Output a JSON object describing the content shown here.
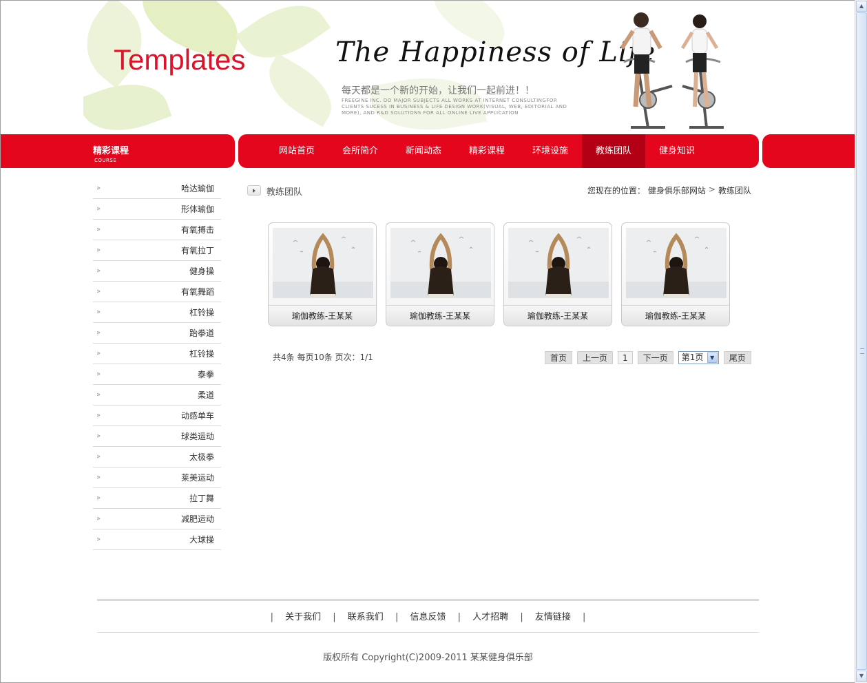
{
  "header": {
    "logo": "Templates",
    "slogan": "The Happiness of Life",
    "slogan_cn": "每天都是一个新的开始，让我们一起前进！！",
    "slogan_en": "FREEGINE INC. DO MAJOR SUBJECTS ALL WORKS AT INTERNET CONSULTINGFOR CLIENTS SUCESS IN BUSINESS & LIFE DESIGN WORK(VISUAL, WEB, EDITORIAL AND MORE), AND R&D SOLUTIONS FOR ALL ONLINE LIVE APPLICATION"
  },
  "sidebar": {
    "title": "精彩课程",
    "subtitle": "COURSE",
    "arrow": "»",
    "items": [
      {
        "label": "哈达瑜伽"
      },
      {
        "label": "形体瑜伽"
      },
      {
        "label": "有氧搏击"
      },
      {
        "label": "有氧拉丁"
      },
      {
        "label": "健身操"
      },
      {
        "label": "有氧舞蹈"
      },
      {
        "label": "杠铃操"
      },
      {
        "label": "跆拳道"
      },
      {
        "label": "杠铃操"
      },
      {
        "label": "泰拳"
      },
      {
        "label": "柔道"
      },
      {
        "label": "动感单车"
      },
      {
        "label": "球类运动"
      },
      {
        "label": "太极拳"
      },
      {
        "label": "莱美运动"
      },
      {
        "label": "拉丁舞"
      },
      {
        "label": "减肥运动"
      },
      {
        "label": "大球操"
      }
    ]
  },
  "nav": {
    "items": [
      {
        "label": "网站首页"
      },
      {
        "label": "会所简介"
      },
      {
        "label": "新闻动态"
      },
      {
        "label": "精彩课程"
      },
      {
        "label": "环境设施"
      },
      {
        "label": "教练团队"
      },
      {
        "label": "健身知识"
      }
    ],
    "active_label": "教练团队"
  },
  "content": {
    "section_title": "教练团队",
    "breadcrumb": {
      "prefix": "您现在的位置：",
      "home": "健身俱乐部网站",
      "separator": ">",
      "current": "教练团队"
    },
    "cards": [
      {
        "caption": "瑜伽教练-王某某"
      },
      {
        "caption": "瑜伽教练-王某某"
      },
      {
        "caption": "瑜伽教练-王某某"
      },
      {
        "caption": "瑜伽教练-王某某"
      }
    ],
    "pager": {
      "info": "共4条  每页10条  页次：1/1",
      "first": "首页",
      "prev": "上一页",
      "current_page": "1",
      "next": "下一页",
      "select_value": "第1页",
      "last": "尾页"
    }
  },
  "footer": {
    "links": [
      {
        "label": "关于我们"
      },
      {
        "label": "联系我们"
      },
      {
        "label": "信息反馈"
      },
      {
        "label": "人才招聘"
      },
      {
        "label": "友情链接"
      }
    ],
    "separator": "|",
    "copyright": "版权所有 Copyright(C)2009-2011 某某健身俱乐部"
  },
  "colors": {
    "brand_red": "#e3061d",
    "nav_active": "#b30015",
    "logo_red": "#d9152e"
  },
  "icons": [
    "arrow-right-icon",
    "chevron-down-icon",
    "scroll-up-icon",
    "scroll-down-icon"
  ]
}
